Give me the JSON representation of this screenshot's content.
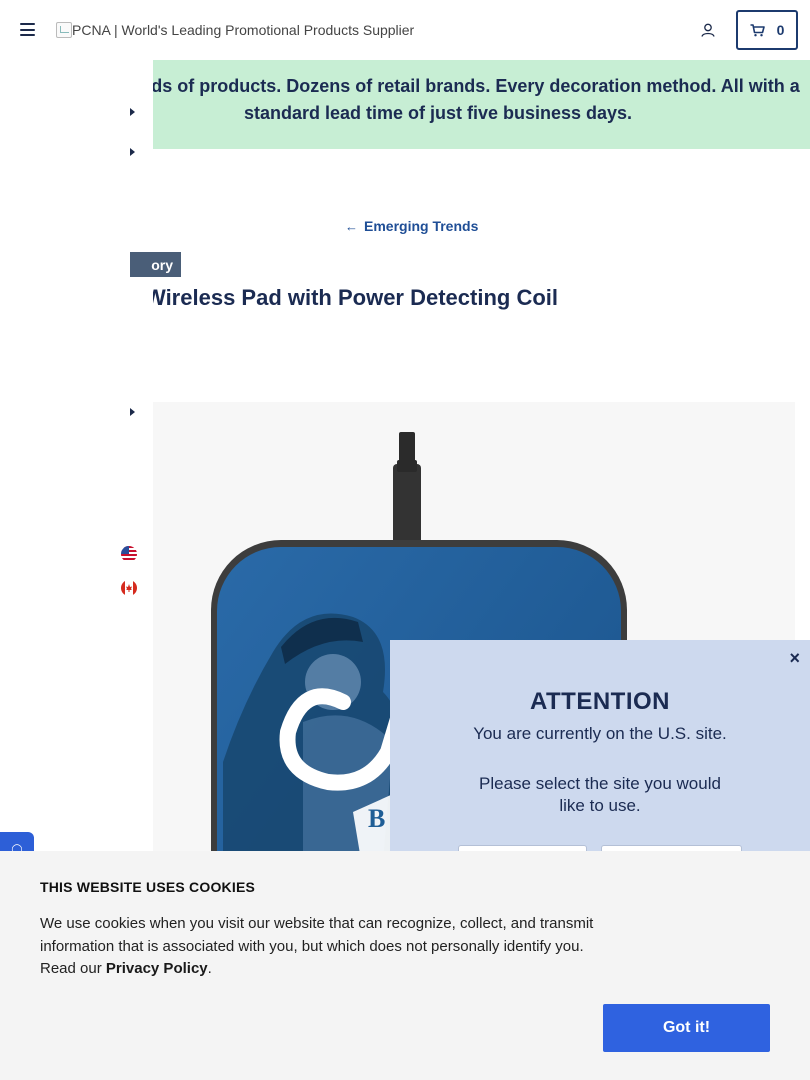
{
  "header": {
    "logo_alt": "PCNA | World's Leading Promotional Products Supplier",
    "cart_count": "0"
  },
  "banner": {
    "text": "Thousands of products. Dozens of retail brands. Every decoration method. All with a standard lead time of just five business days."
  },
  "back_link": {
    "label": "Emerging Trends"
  },
  "tag": {
    "label": "ory"
  },
  "title": "Wireless Pad with Power Detecting Coil",
  "attention": {
    "close": "×",
    "heading": "ATTENTION",
    "line1": "You are currently on the U.S. site.",
    "line2": "Please select the site you would like to use."
  },
  "cookies": {
    "heading": "THIS WEBSITE USES COOKIES",
    "body": "We use cookies when you visit our website that can recognize, collect, and transmit information that is associated with you, but which does not personally identify you. Read our",
    "link": "Privacy Policy",
    "period": ".",
    "button": "Got it!"
  },
  "colors": {
    "navy": "#1b2b52",
    "banner_bg": "#c7eed4",
    "modal_bg": "#cdd9ee",
    "accent_blue": "#2f62e0",
    "product_blue": "#1f5e96"
  },
  "icons": [
    "hamburger-icon",
    "user-icon",
    "cart-icon",
    "arrow-left-icon",
    "us-flag-icon",
    "canada-flag-icon",
    "close-icon",
    "chat-icon"
  ]
}
